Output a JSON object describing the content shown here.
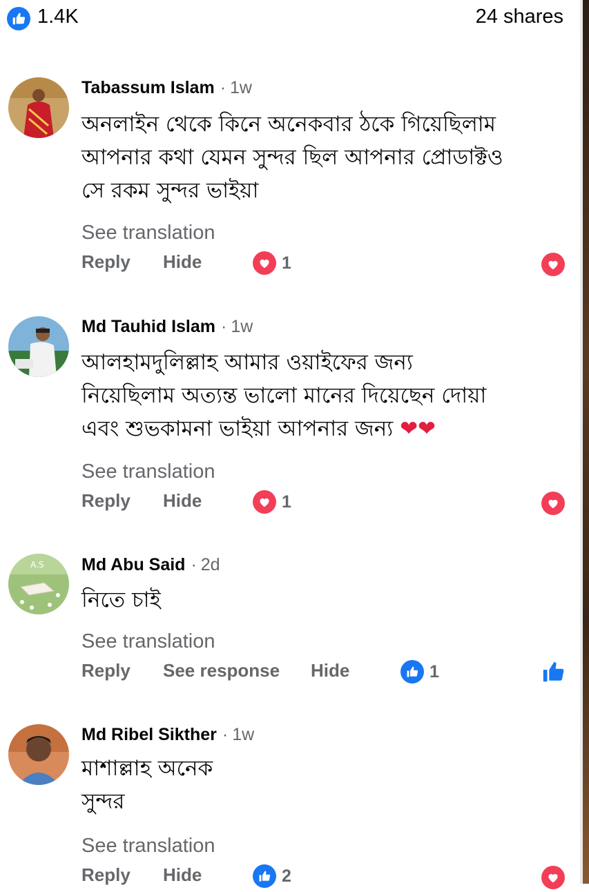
{
  "post_stats": {
    "reactions": "1.4K",
    "shares": "24 shares",
    "reaction_icon": "like-icon",
    "accent": "#1877f2"
  },
  "comments": [
    {
      "author": "Tabassum Islam",
      "time": "1w",
      "text_lines": [
        "অনলাইন থেকে কিনে অনেকবার ঠকে গিয়েছিলাম",
        "আপনার কথা যেমন সুন্দর ছিল আপনার প্রোডাক্টও",
        "সে রকম সুন্দর ভাইয়া"
      ],
      "see_translation": "See translation",
      "reply": "Reply",
      "hide": "Hide",
      "reaction_icon": "love-icon",
      "reaction_count": "1",
      "user_reaction_icon": "love-icon"
    },
    {
      "author": "Md Tauhid Islam",
      "time": "1w",
      "text_lines": [
        "আলহামদুলিল্লাহ আমার ওয়াইফের জন্য",
        "নিয়েছিলাম অত্যন্ত ভালো মানের দিয়েছেন দোয়া",
        "এবং শুভকামনা ভাইয়া আপনার জন্য"
      ],
      "emoji": "❤❤",
      "see_translation": "See translation",
      "reply": "Reply",
      "hide": "Hide",
      "reaction_icon": "love-icon",
      "reaction_count": "1",
      "user_reaction_icon": "love-icon"
    },
    {
      "author": "Md Abu Said",
      "time": "2d",
      "avatar_label": "A.S",
      "text_lines": [
        "নিতে চাই"
      ],
      "see_translation": "See translation",
      "reply": "Reply",
      "see_response": "See response",
      "hide": "Hide",
      "reaction_icon": "like-icon",
      "reaction_count": "1",
      "user_reaction_icon": "thumbs-up-icon"
    },
    {
      "author": "Md Ribel Sikther",
      "time": "1w",
      "text_lines": [
        "মাশাল্লাহ অনেক",
        "সুন্দর"
      ],
      "see_translation": "See translation",
      "reply": "Reply",
      "hide": "Hide",
      "reaction_icon": "like-icon",
      "reaction_count": "2",
      "user_reaction_icon": "love-icon"
    }
  ],
  "colors": {
    "love": "#f33e58",
    "like": "#1877f2",
    "secondary_text": "#65676b"
  }
}
